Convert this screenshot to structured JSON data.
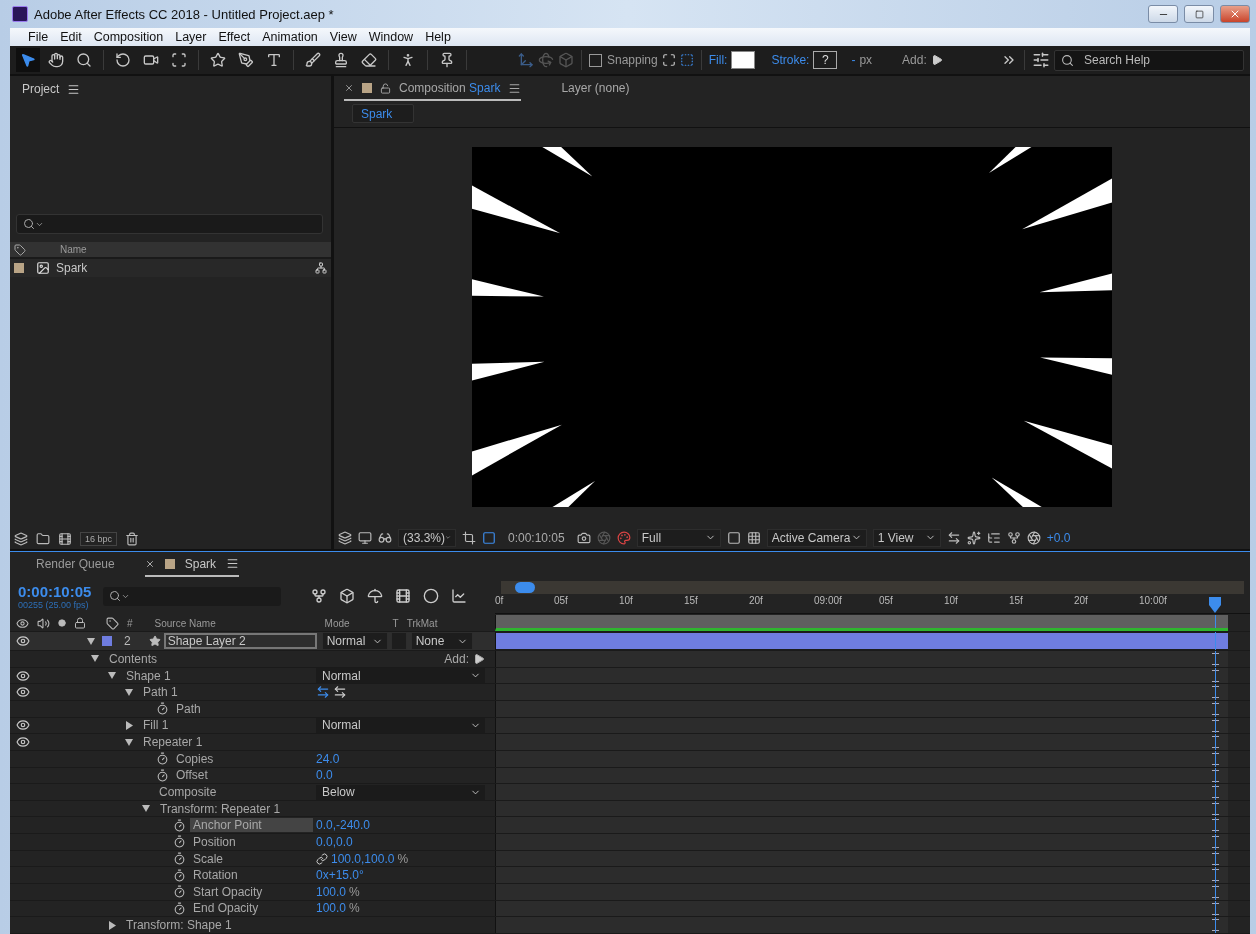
{
  "window": {
    "title": "Adobe After Effects CC 2018 - Untitled Project.aep *"
  },
  "menu": [
    "File",
    "Edit",
    "Composition",
    "Layer",
    "Effect",
    "Animation",
    "View",
    "Window",
    "Help"
  ],
  "toolbar": {
    "tools": [
      {
        "kind": "selection",
        "selected": true
      },
      {
        "kind": "hand",
        "selected": false
      },
      {
        "kind": "zoom",
        "selected": false
      },
      {
        "kind": "rotate",
        "selected": false
      },
      {
        "kind": "camera",
        "selected": false
      },
      {
        "kind": "pan-behind",
        "selected": false
      },
      {
        "kind": "shape",
        "selected": false
      },
      {
        "kind": "pen",
        "selected": false
      },
      {
        "kind": "type",
        "selected": false
      },
      {
        "kind": "brush",
        "selected": false
      },
      {
        "kind": "clone",
        "selected": false
      },
      {
        "kind": "eraser",
        "selected": false
      },
      {
        "kind": "roto",
        "selected": false
      },
      {
        "kind": "puppet",
        "selected": false
      }
    ],
    "snapping": {
      "label": "Snapping",
      "checked": false
    },
    "fill_label": "Fill:",
    "stroke_label": "Stroke:",
    "stroke_value": "?",
    "stroke_width": "-",
    "stroke_unit": "px",
    "add_label": "Add:",
    "search": {
      "placeholder": "Search Help"
    }
  },
  "project": {
    "title": "Project",
    "column": "Name",
    "items": [
      {
        "name": "Spark",
        "color": "#b9a486",
        "selected": false
      }
    ],
    "bit_depth": "16 bpc"
  },
  "composition": {
    "tabs": [
      {
        "prefix": "Composition",
        "name": "Spark",
        "selected": true
      },
      {
        "prefix": "Layer",
        "name": "(none)",
        "selected": false
      }
    ],
    "breadcrumb": "Spark",
    "zoom": "(33.3%)",
    "timecode": "0:00:10:05",
    "resolution": "Full",
    "camera": "Active Camera",
    "views": "1 View",
    "exposure": "+0.0"
  },
  "timeline": {
    "tabs": [
      {
        "label": "Render Queue",
        "selected": false
      },
      {
        "label": "Spark",
        "selected": true
      }
    ],
    "timecode": "0:00:10:05",
    "frame_info": "00255 (25.00 fps)",
    "columns": {
      "number": "#",
      "source": "Source Name",
      "mode": "Mode",
      "t": "T",
      "trkmat": "TrkMat"
    },
    "ruler": [
      "0f",
      "05f",
      "10f",
      "15f",
      "20f",
      "09:00f",
      "05f",
      "10f",
      "15f",
      "20f",
      "10:00f"
    ],
    "playhead": {
      "level": 0.982
    },
    "layer": {
      "number": "2",
      "name": "Shape Layer 2",
      "mode": "Normal",
      "trkmat": "None",
      "color": "#6f7de0",
      "expanded": true,
      "visible": true
    },
    "add_label": "Add:",
    "properties": [
      {
        "kind": "group",
        "name": "Contents",
        "expanded": true,
        "add": true,
        "selected": false,
        "children": [
          {
            "kind": "group",
            "name": "Shape 1",
            "expanded": true,
            "visible": true,
            "mode": "Normal",
            "selected": false,
            "children": [
              {
                "kind": "group",
                "name": "Path 1",
                "expanded": true,
                "visible": true,
                "direction_buttons": true,
                "selected": false,
                "children": [
                  {
                    "kind": "property",
                    "name": "Path",
                    "selected": false
                  }
                ]
              },
              {
                "kind": "group",
                "name": "Fill 1",
                "expanded": false,
                "visible": true,
                "mode": "Normal",
                "selected": false
              },
              {
                "kind": "group",
                "name": "Repeater 1",
                "expanded": true,
                "visible": true,
                "selected": false,
                "children": [
                  {
                    "kind": "property",
                    "name": "Copies",
                    "value": "24.0",
                    "selected": false
                  },
                  {
                    "kind": "property",
                    "name": "Offset",
                    "value": "0.0",
                    "selected": false
                  },
                  {
                    "kind": "option",
                    "name": "Composite",
                    "mode": "Below",
                    "selected": false
                  },
                  {
                    "kind": "group",
                    "name": "Transform: Repeater 1",
                    "expanded": true,
                    "selected": false,
                    "children": [
                      {
                        "kind": "property",
                        "name": "Anchor Point",
                        "value": "0.0,-240.0",
                        "selected": true
                      },
                      {
                        "kind": "property",
                        "name": "Position",
                        "value": "0.0,0.0",
                        "selected": false
                      },
                      {
                        "kind": "property",
                        "name": "Scale",
                        "value": "100.0,100.0",
                        "unit": "%",
                        "linked": true,
                        "selected": false
                      },
                      {
                        "kind": "property",
                        "name": "Rotation",
                        "value": "0x+15.0°",
                        "selected": false
                      },
                      {
                        "kind": "property",
                        "name": "Start Opacity",
                        "value": "100.0",
                        "unit": "%",
                        "selected": false
                      },
                      {
                        "kind": "property",
                        "name": "End Opacity",
                        "value": "100.0",
                        "unit": "%",
                        "selected": false
                      }
                    ]
                  }
                ]
              }
            ]
          },
          {
            "kind": "group",
            "name": "Transform: Shape 1",
            "expanded": false,
            "selected": false
          }
        ]
      }
    ]
  }
}
